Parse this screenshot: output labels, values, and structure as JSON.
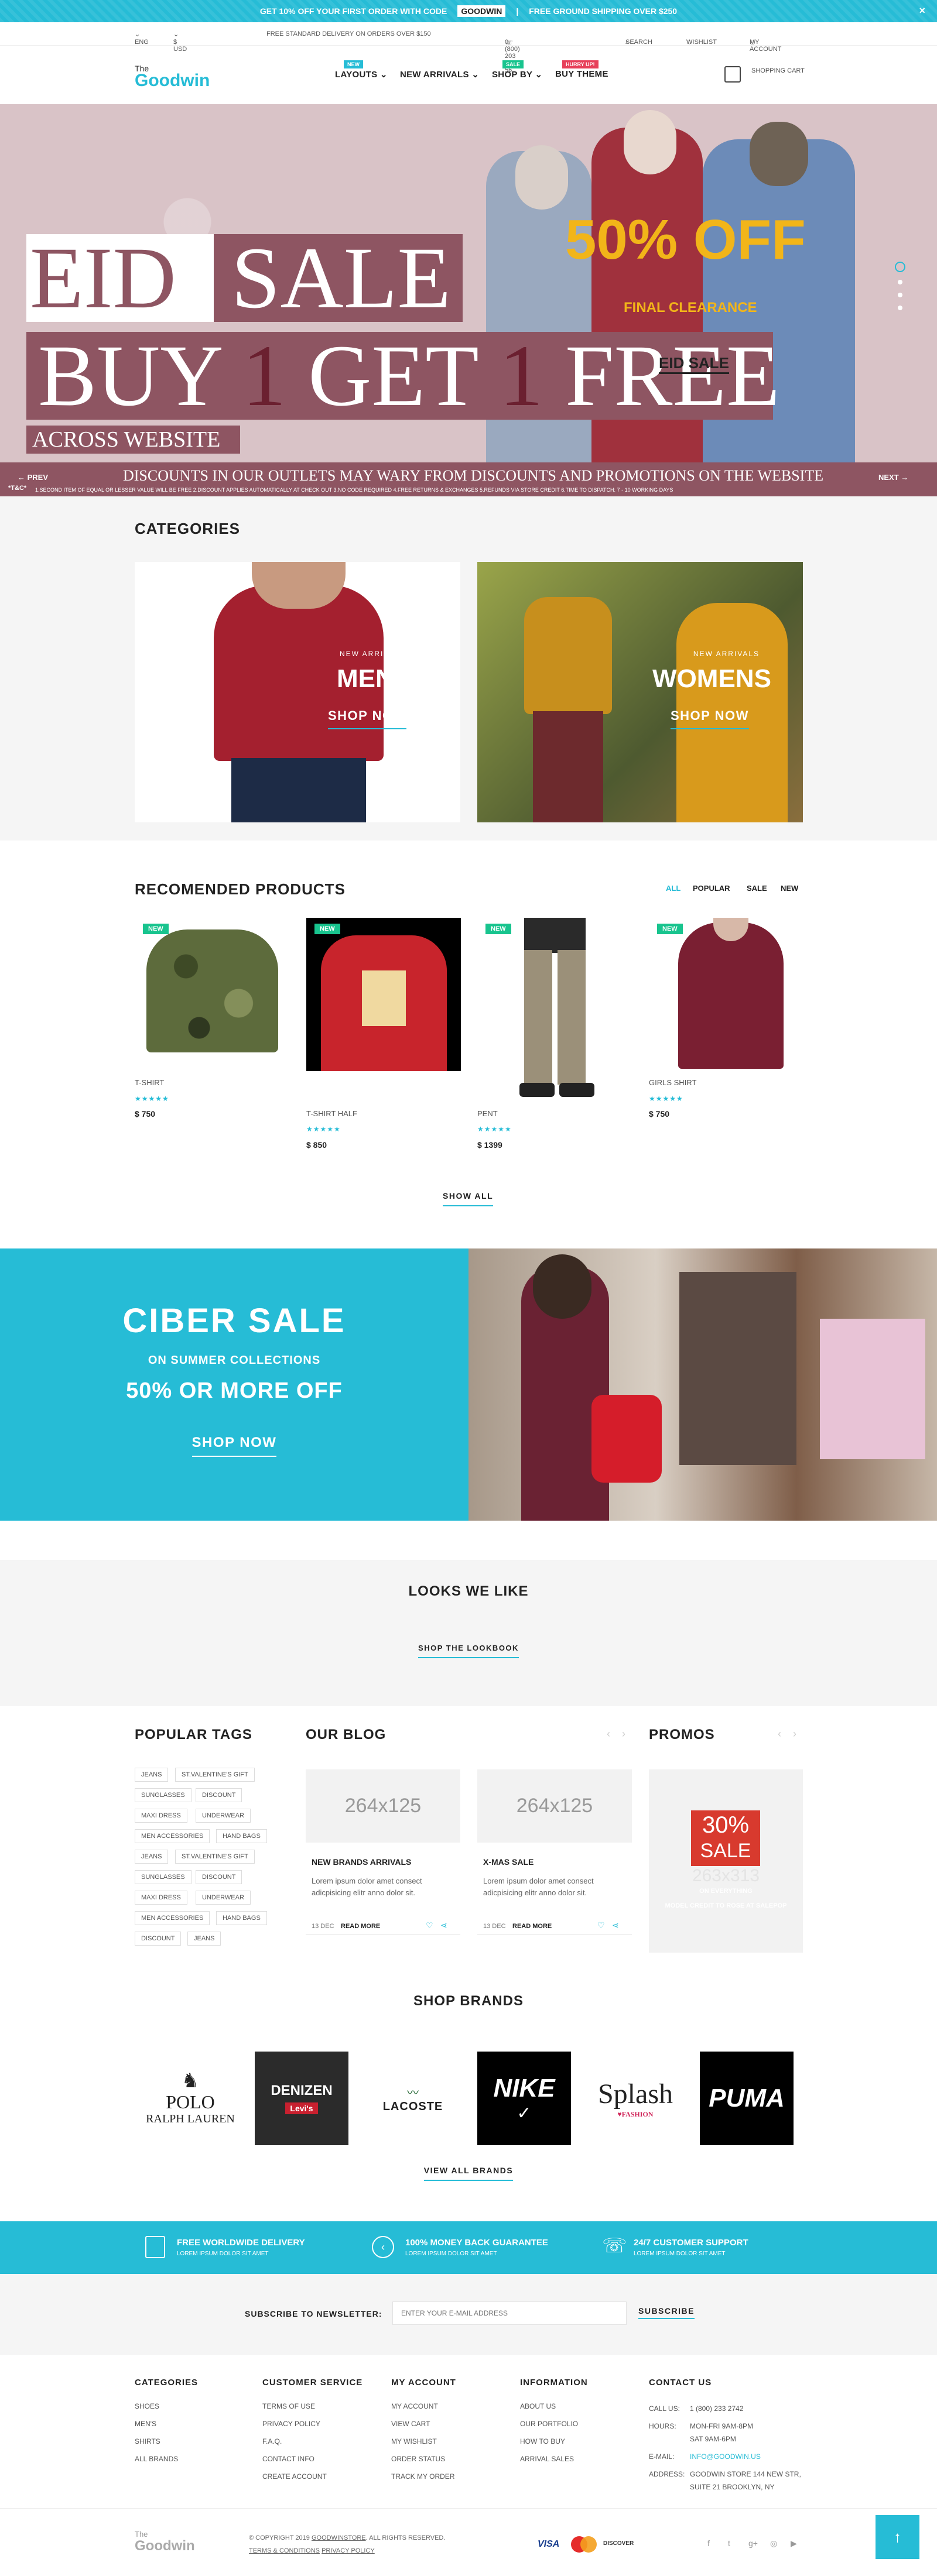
{
  "topbar": {
    "promo": "GET 10% OFF YOUR FIRST ORDER WITH CODE",
    "code": "GOODWIN",
    "shipping": "FREE GROUND SHIPPING OVER $250",
    "close": "×"
  },
  "util": {
    "lang": "ENG",
    "currency": "$ USD",
    "delivery": "FREE STANDARD DELIVERY ON ORDERS OVER $150",
    "phone": "0 (800) 203 98 56",
    "search": "SEARCH",
    "wishlist": "WISHLIST",
    "account": "MY ACCOUNT"
  },
  "header": {
    "logo_the": "The",
    "logo_name": "Goodwin",
    "cart": "SHOPPING CART",
    "nav": [
      {
        "label": "LAYOUTS",
        "badge": "NEW",
        "badge_color": "#26bcd6"
      },
      {
        "label": "NEW ARRIVALS",
        "badge": "",
        "badge_color": ""
      },
      {
        "label": "SHOP BY",
        "badge": "SALE",
        "badge_color": "#18c48e"
      },
      {
        "label": "BUY THEME",
        "badge": "HURRY UP!",
        "badge_color": "#e7405a"
      }
    ]
  },
  "hero": {
    "eid": "EID",
    "sale": "SALE",
    "bogo_a": "BUY ",
    "bogo_b": "1",
    "bogo_c": " GET ",
    "bogo_d": "1",
    "bogo_e": " FREE",
    "across": "ACROSS WEBSITE",
    "off": "50% OFF",
    "final": "FINAL CLEARANCE",
    "eid_sale": "EID SALE",
    "prev": "PREV",
    "next": "NEXT",
    "discounts": "DISCOUNTS IN OUR OUTLETS MAY WARY FROM DISCOUNTS AND PROMOTIONS ON THE WEBSITE",
    "tc": "*T&C*",
    "terms": "1.SECOND ITEM OF EQUAL OR LESSER VALUE WILL BE FREE    2.DISCOUNT APPLIES AUTOMATICALLY AT CHECK OUT    3.NO CODE REQUIRED    4.FREE RETURNS & EXCHANGES    5.REFUNDS VIA STORE CREDIT    6.TIME TO DISPATCH: 7 - 10 WORKING DAYS"
  },
  "categories": {
    "title": "CATEGORIES",
    "items": [
      {
        "sub": "NEW ARRIVALS",
        "title": "MENS",
        "cta": "SHOP NOW"
      },
      {
        "sub": "NEW ARRIVALS",
        "title": "WOMENS",
        "cta": "SHOP NOW"
      }
    ]
  },
  "recommended": {
    "title": "RECOMENDED PRODUCTS",
    "filters": [
      "ALL",
      "POPULAR",
      "SALE",
      "NEW"
    ],
    "show_all": "SHOW ALL",
    "products": [
      {
        "tag": "NEW",
        "name": "T-SHIRT",
        "stars": "★★★★★",
        "price": "$ 750"
      },
      {
        "tag": "NEW",
        "name": "T-SHIRT HALF",
        "stars": "★★★★★",
        "price": "$ 850"
      },
      {
        "tag": "NEW",
        "name": "PENT",
        "stars": "★★★★★",
        "price": "$ 1399"
      },
      {
        "tag": "NEW",
        "name": "GIRLS SHIRT",
        "stars": "★★★★★",
        "price": "$ 750"
      }
    ]
  },
  "ciber": {
    "title": "CIBER SALE",
    "sub": "ON SUMMER COLLECTIONS",
    "off": "50% OR MORE OFF",
    "cta": "SHOP NOW"
  },
  "looks": {
    "title": "LOOKS WE LIKE",
    "cta": "SHOP THE LOOKBOOK"
  },
  "tags": {
    "title": "POPULAR TAGS",
    "items": [
      "JEANS",
      "ST.VALENTINE'S GIFT",
      "SUNGLASSES",
      "DISCOUNT",
      "MAXI DRESS",
      "UNDERWEAR",
      "MEN ACCESSORIES",
      "HAND BAGS",
      "JEANS",
      "ST.VALENTINE'S GIFT",
      "SUNGLASSES",
      "DISCOUNT",
      "MAXI DRESS",
      "UNDERWEAR",
      "MEN ACCESSORIES",
      "HAND BAGS",
      "DISCOUNT",
      "JEANS"
    ]
  },
  "blog": {
    "title": "OUR BLOG",
    "posts": [
      {
        "img": "264x125",
        "title": "NEW BRANDS ARRIVALS",
        "text": "Lorem ipsum dolor amet consect adicpisicing elitr anno dolor sit.",
        "date": "13 DEC",
        "more": "READ MORE"
      },
      {
        "img": "264x125",
        "title": "X-MAS SALE",
        "text": "Lorem ipsum dolor amet consect adicpisicing elitr anno dolor sit.",
        "date": "13 DEC",
        "more": "READ MORE"
      }
    ]
  },
  "promos": {
    "title": "PROMOS",
    "img": "263x313",
    "pct": "30%",
    "sale": "SALE",
    "line1": "ON EVERYTHING",
    "line2": "MODEL CREDIT TO ROSE AT SALEPOP"
  },
  "brands": {
    "title": "SHOP BRANDS",
    "cta": "VIEW ALL BRANDS",
    "items": [
      {
        "line1": "POLO",
        "line2": "RALPH LAUREN"
      },
      {
        "line1": "DENIZEN",
        "line2": "Levi's"
      },
      {
        "line1": "LACOSTE",
        "line2": ""
      },
      {
        "line1": "NIKE",
        "line2": ""
      },
      {
        "line1": "Splash",
        "line2": "FASHION"
      },
      {
        "line1": "PUMA",
        "line2": ""
      }
    ]
  },
  "features": [
    {
      "title": "FREE WORLDWIDE DELIVERY",
      "sub": "LOREM IPSUM DOLOR SIT AMET"
    },
    {
      "title": "100% MONEY BACK GUARANTEE",
      "sub": "LOREM IPSUM DOLOR SIT AMET"
    },
    {
      "title": "24/7 CUSTOMER SUPPORT",
      "sub": "LOREM IPSUM DOLOR SIT AMET"
    }
  ],
  "newsletter": {
    "label": "SUBSCRIBE TO NEWSLETTER:",
    "placeholder": "ENTER YOUR E-MAIL ADDRESS",
    "button": "SUBSCRIBE"
  },
  "footer": {
    "cols": [
      {
        "title": "CATEGORIES",
        "items": [
          "SHOES",
          "MEN'S",
          "SHIRTS",
          "ALL BRANDS"
        ]
      },
      {
        "title": "CUSTOMER SERVICE",
        "items": [
          "TERMS OF USE",
          "PRIVACY POLICY",
          "F.A.Q.",
          "CONTACT INFO",
          "CREATE ACCOUNT"
        ]
      },
      {
        "title": "MY ACCOUNT",
        "items": [
          "MY ACCOUNT",
          "VIEW CART",
          "MY WISHLIST",
          "ORDER STATUS",
          "TRACK MY ORDER"
        ]
      },
      {
        "title": "INFORMATION",
        "items": [
          "ABOUT US",
          "OUR PORTFOLIO",
          "HOW TO BUY",
          "ARRIVAL SALES"
        ]
      }
    ],
    "contact": {
      "title": "CONTACT US",
      "call_l": "CALL US:",
      "call": "1 (800) 233 2742",
      "hours_l": "HOURS:",
      "hours1": "MON-FRI 9AM-8PM",
      "hours2": "SAT 9AM-6PM",
      "email_l": "E-MAIL:",
      "email": "INFO@GOODWIN.US",
      "addr_l": "ADDRESS:",
      "addr1": "GOODWIN STORE 144 NEW STR,",
      "addr2": "SUITE 21 BROOKLYN, NY"
    },
    "copy1": "© COPYRIGHT 2019",
    "copy_link": "GOODWINSTORE",
    "copy2": ". ALL RIGHTS RESERVED.",
    "terms": "TERMS & CONDITIONS",
    "privacy": "PRIVACY POLICY",
    "pay": [
      "VISA",
      "MC",
      "DISCOVER"
    ]
  },
  "colors": {
    "accent": "#26bcd6",
    "maroon": "#8e5562",
    "gold": "#f2b519",
    "green": "#18c48e"
  }
}
